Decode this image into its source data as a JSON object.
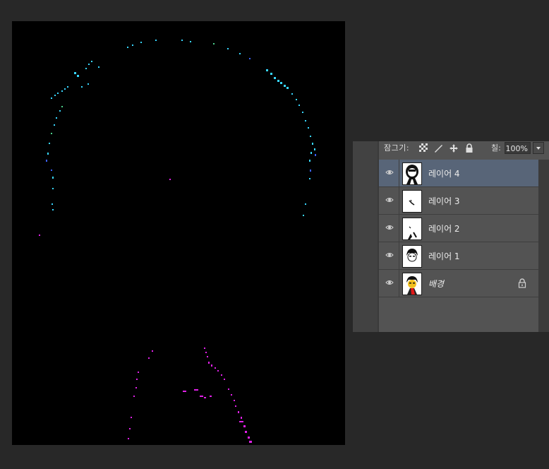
{
  "layers_panel": {
    "lock_label": "잠그기:",
    "fill_label": "칠:",
    "fill_value": "100%",
    "lock_icons": [
      "lock-transparent-pixels-icon",
      "lock-image-pixels-icon",
      "lock-position-icon",
      "lock-all-icon"
    ],
    "layers": [
      {
        "name": "레이어 4",
        "selected": true,
        "visible": true
      },
      {
        "name": "레이어 3",
        "selected": false,
        "visible": true
      },
      {
        "name": "레이어 2",
        "selected": false,
        "visible": true
      },
      {
        "name": "레이어 1",
        "selected": false,
        "visible": true
      },
      {
        "name": "배경",
        "selected": false,
        "visible": true,
        "locked": true,
        "italic": true
      }
    ]
  },
  "colors": {
    "app_background": "#282828",
    "canvas_background": "#000000",
    "selected_layer": "#586578",
    "stroke_cyan": "#37d6ff",
    "stroke_magenta": "#e020e8"
  }
}
